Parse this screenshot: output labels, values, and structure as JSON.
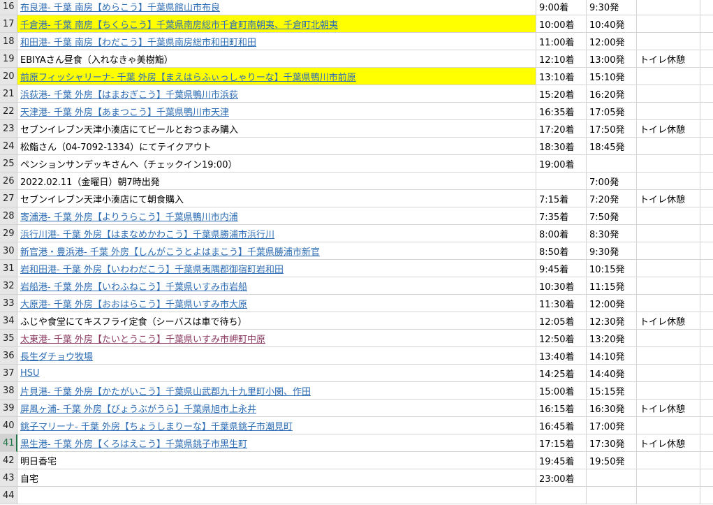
{
  "rows": [
    {
      "n": "16",
      "a": "布良港- 千葉 南房【めらこう】千葉県館山市布良",
      "b": "9:00着",
      "c": "9:30発",
      "d": "",
      "style": "link"
    },
    {
      "n": "17",
      "a": "千倉港- 千葉 南房【ちくらこう】千葉県南房総市千倉町南朝夷、千倉町北朝夷",
      "b": "10:00着",
      "c": "10:40発",
      "d": "",
      "style": "link",
      "hl": true
    },
    {
      "n": "18",
      "a": "和田港- 千葉 南房【わだこう】千葉県南房総市和田町和田",
      "b": "11:00着",
      "c": "12:00発",
      "d": "",
      "style": "link"
    },
    {
      "n": "19",
      "a": "EBIYAさん昼食（入れなきゃ美樹鮨）",
      "b": "12:10着",
      "c": "13:00発",
      "d": "トイレ休憩",
      "style": "plain"
    },
    {
      "n": "20",
      "a": "前原フィッシャリーナ- 千葉 外房【まえはらふぃっしゃりーな】千葉県鴨川市前原",
      "b": "13:10着",
      "c": "15:10発",
      "d": "",
      "style": "link",
      "hl": true
    },
    {
      "n": "21",
      "a": "浜荻港- 千葉 外房【はまおぎこう】千葉県鴨川市浜荻",
      "b": "15:20着",
      "c": "16:20発",
      "d": "",
      "style": "link"
    },
    {
      "n": "22",
      "a": "天津港- 千葉 外房【あまつこう】千葉県鴨川市天津",
      "b": "16:35着",
      "c": "17:05発",
      "d": "",
      "style": "link"
    },
    {
      "n": "23",
      "a": "セブンイレブン天津小湊店にてビールとおつまみ購入",
      "b": "17:20着",
      "c": "17:50発",
      "d": "トイレ休憩",
      "style": "plain"
    },
    {
      "n": "24",
      "a": "松鮨さん（04-7092-1334）にてテイクアウト",
      "b": "18:30着",
      "c": "18:45発",
      "d": "",
      "style": "plain"
    },
    {
      "n": "25",
      "a": "ペンションサンデッキさんへ（チェックイン19:00）",
      "b": "19:00着",
      "c": "",
      "d": "",
      "style": "plain"
    },
    {
      "n": "26",
      "a": "2022.02.11（金曜日）朝7時出発",
      "b": "",
      "c": "7:00発",
      "d": "",
      "style": "plain"
    },
    {
      "n": "27",
      "a": "セブンイレブン天津小湊店にて朝食購入",
      "b": "7:15着",
      "c": "7:20発",
      "d": "トイレ休憩",
      "style": "plain"
    },
    {
      "n": "28",
      "a": "寄浦港- 千葉 外房【よりうらこう】千葉県鴨川市内浦",
      "b": "7:35着",
      "c": "7:50発",
      "d": "",
      "style": "link"
    },
    {
      "n": "29",
      "a": "浜行川港- 千葉 外房【はまなめかわこう】千葉県勝浦市浜行川",
      "b": "8:00着",
      "c": "8:30発",
      "d": "",
      "style": "link"
    },
    {
      "n": "30",
      "a": "新官港・豊浜港- 千葉 外房【しんがこうとよはまこう】千葉県勝浦市新官",
      "b": "8:50着",
      "c": "9:30発",
      "d": "",
      "style": "link"
    },
    {
      "n": "31",
      "a": "岩和田港- 千葉 外房【いわわだこう】千葉県夷隅郡御宿町岩和田",
      "b": "9:45着",
      "c": "10:15発",
      "d": "",
      "style": "link"
    },
    {
      "n": "32",
      "a": "岩船港- 千葉 外房【いわふねこう】千葉県いすみ市岩船",
      "b": "10:30着",
      "c": "11:15発",
      "d": "",
      "style": "link"
    },
    {
      "n": "33",
      "a": "大原港- 千葉 外房【おおはらこう】千葉県いすみ市大原",
      "b": "11:30着",
      "c": "12:00発",
      "d": "",
      "style": "link"
    },
    {
      "n": "34",
      "a": "ふじや食堂にてキスフライ定食（シーバスは車で待ち）",
      "b": "12:05着",
      "c": "12:30発",
      "d": "トイレ休憩",
      "style": "plain"
    },
    {
      "n": "35",
      "a": "太東港- 千葉 外房【たいとうこう】千葉県いすみ市岬町中原",
      "b": "12:50着",
      "c": "13:20発",
      "d": "",
      "style": "visited"
    },
    {
      "n": "36",
      "a": "長生ダチョウ牧場",
      "b": "13:40着",
      "c": "14:10発",
      "d": "",
      "style": "link"
    },
    {
      "n": "37",
      "a": "HSU",
      "b": "14:25着",
      "c": "14:40発",
      "d": "",
      "style": "link"
    },
    {
      "n": "38",
      "a": "片貝港- 千葉 外房【かたがいこう】千葉県山武郡九十九里町小関、作田",
      "b": "15:00着",
      "c": "15:15発",
      "d": "",
      "style": "link"
    },
    {
      "n": "39",
      "a": "屏風ヶ浦- 千葉 外房【びょうぶがうら】千葉県旭市上永井",
      "b": "16:15着",
      "c": "16:30発",
      "d": "トイレ休憩",
      "style": "link"
    },
    {
      "n": "40",
      "a": "銚子マリーナ- 千葉 外房【ちょうしまりーな】千葉県銚子市潮見町",
      "b": "16:45着",
      "c": "17:00発",
      "d": "",
      "style": "link"
    },
    {
      "n": "41",
      "a": "黒生港- 千葉 外房【くろはえこう】千葉県銚子市黒生町",
      "b": "17:15着",
      "c": "17:30発",
      "d": "トイレ休憩",
      "style": "link",
      "active": true
    },
    {
      "n": "42",
      "a": "明日香宅",
      "b": "19:45着",
      "c": "19:50発",
      "d": "",
      "style": "plain"
    },
    {
      "n": "43",
      "a": "自宅",
      "b": "23:00着",
      "c": "",
      "d": "",
      "style": "plain"
    },
    {
      "n": "44",
      "a": "",
      "b": "",
      "c": "",
      "d": "",
      "style": "plain"
    }
  ]
}
